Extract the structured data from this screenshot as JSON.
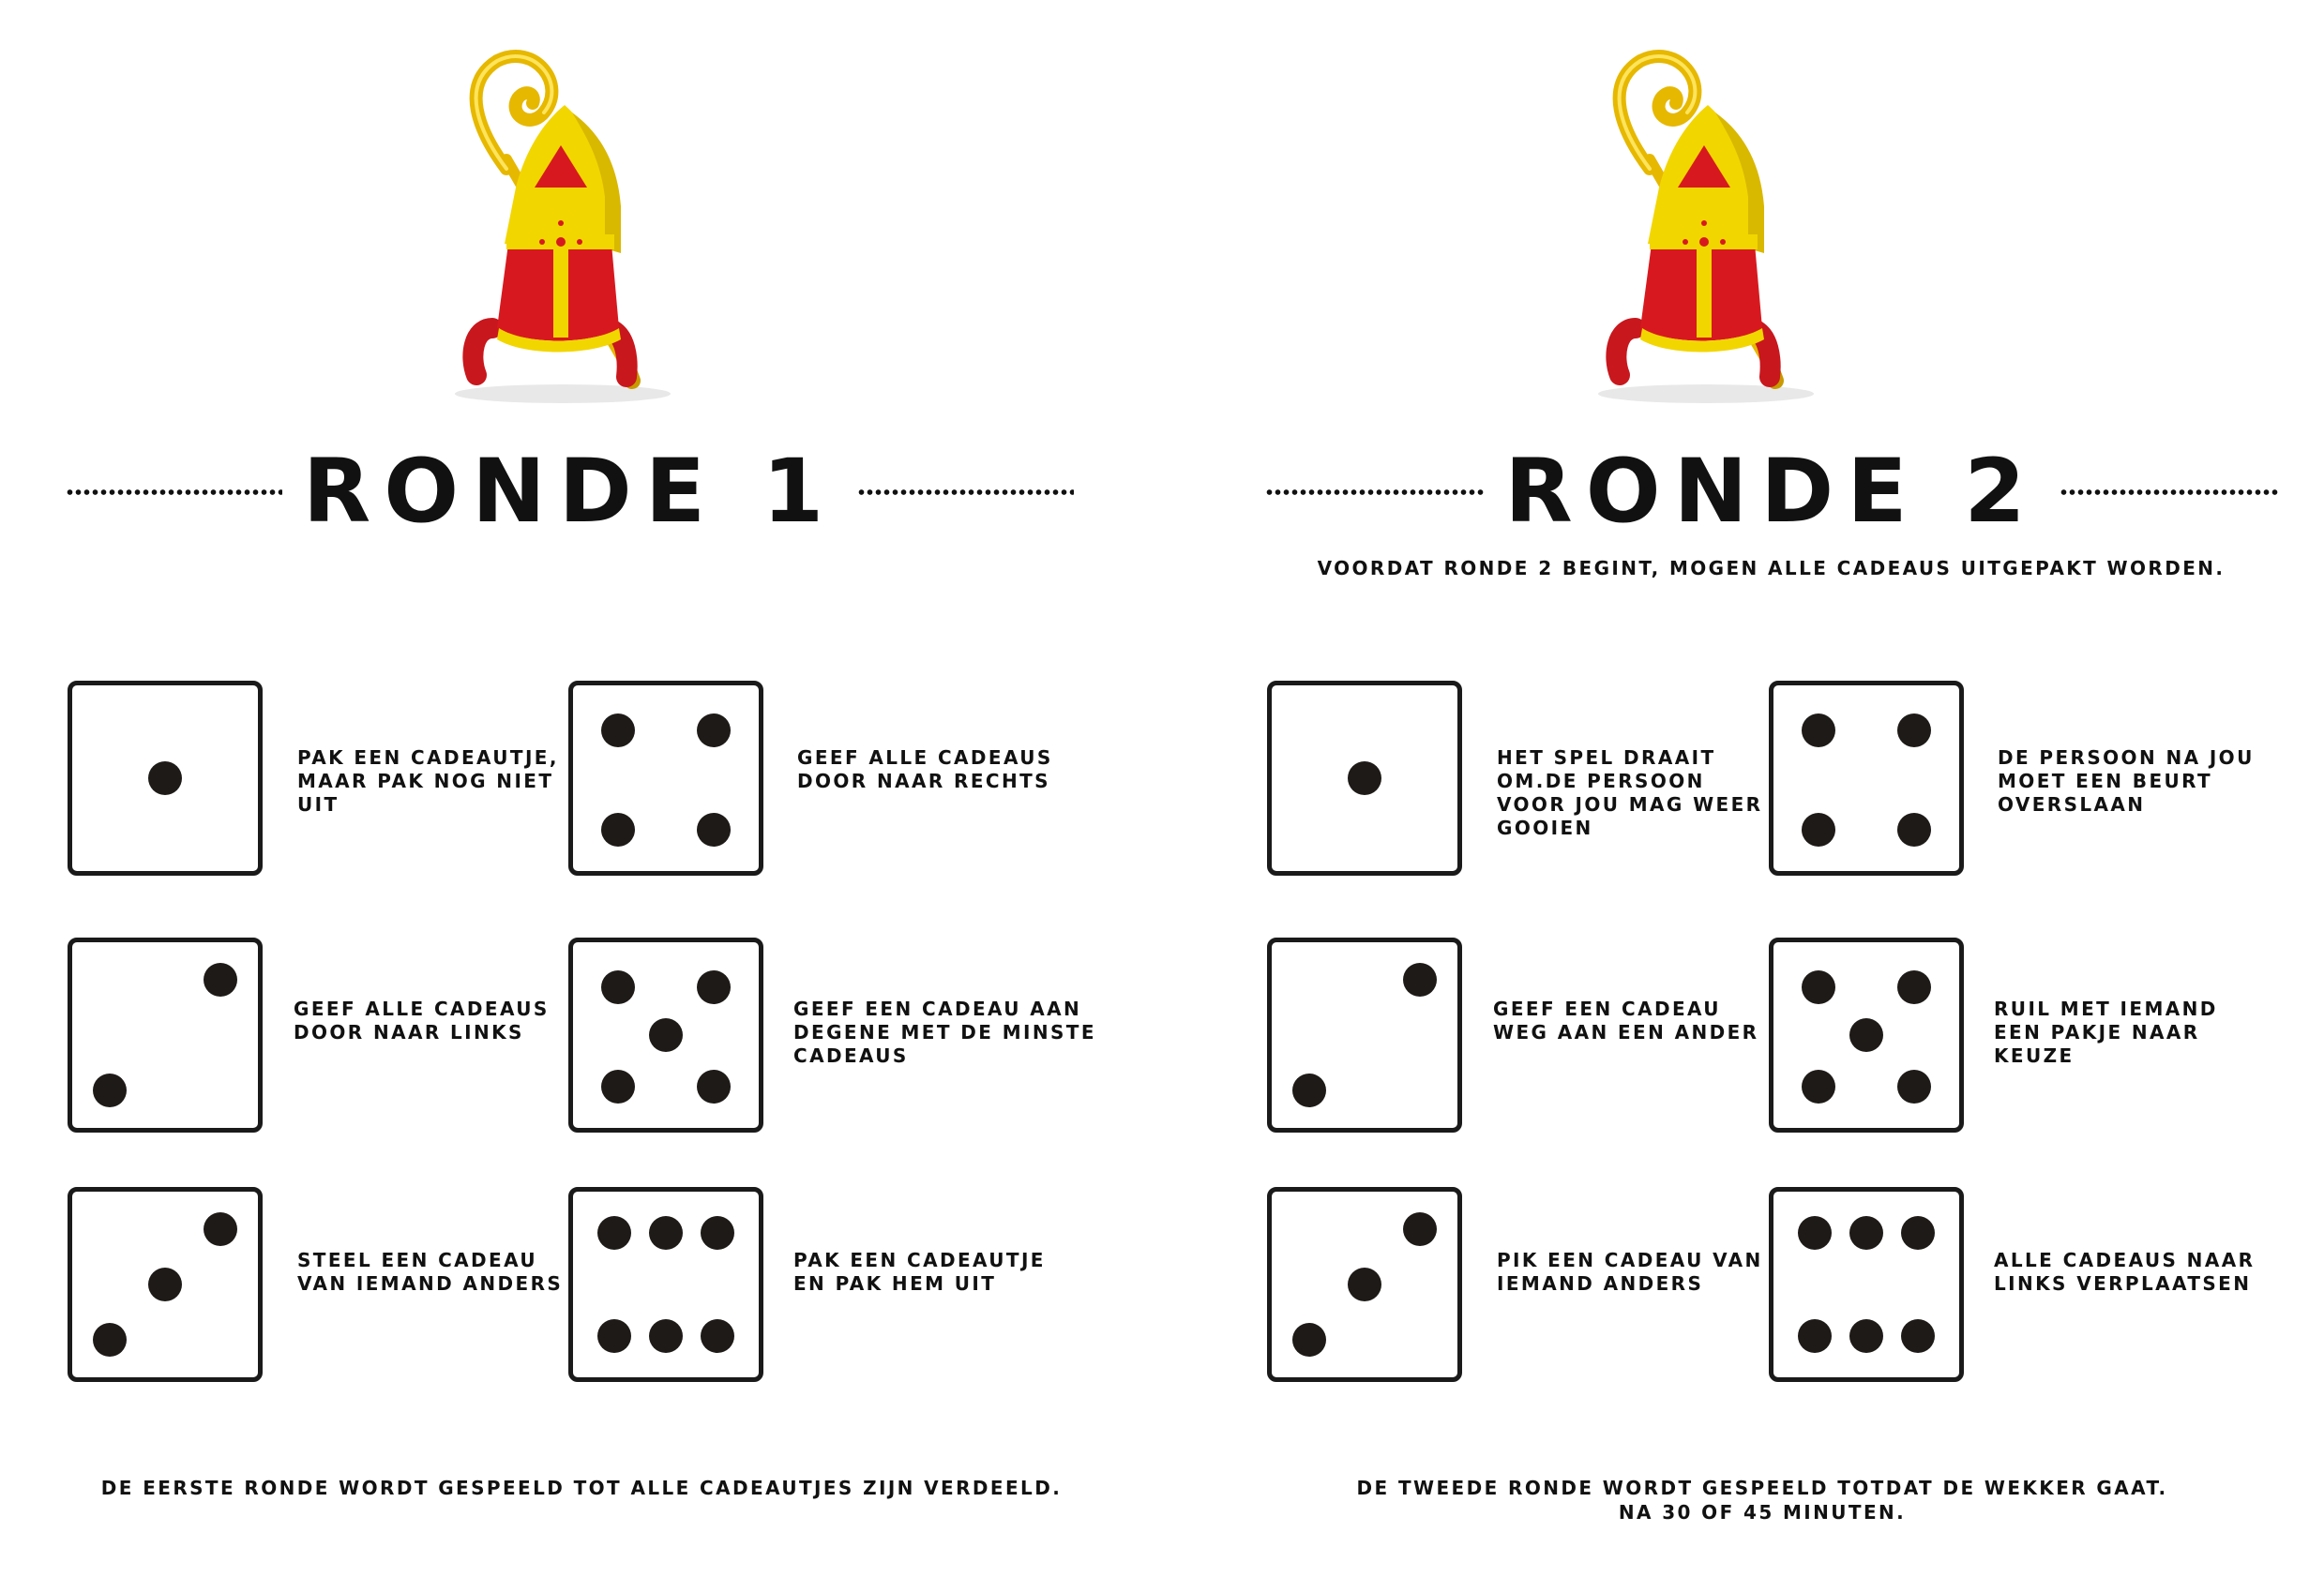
{
  "rounds": [
    {
      "title": "RONDE 1",
      "subtitle": "",
      "items": [
        {
          "die": 1,
          "text": "PAK EEN CADEAUTJE, MAAR PAK NOG NIET UIT"
        },
        {
          "die": 2,
          "text": "GEEF ALLE CADEAUS DOOR NAAR LINKS"
        },
        {
          "die": 3,
          "text": "STEEL EEN CADEAU VAN IEMAND ANDERS"
        },
        {
          "die": 4,
          "text": "GEEF ALLE CADEAUS DOOR NAAR RECHTS"
        },
        {
          "die": 5,
          "text": "GEEF EEN CADEAU AAN DEGENE MET DE MINSTE CADEAUS"
        },
        {
          "die": 6,
          "text": "PAK EEN CADEAUTJE EN PAK HEM UIT"
        }
      ],
      "footer": "DE EERSTE RONDE WORDT GESPEELD TOT ALLE CADEAUTJES ZIJN VERDEELD.",
      "footer_line2": ""
    },
    {
      "title": "RONDE 2",
      "subtitle": "VOORDAT RONDE 2 BEGINT, MOGEN ALLE CADEAUS UITGEPAKT WORDEN.",
      "items": [
        {
          "die": 1,
          "text": "HET SPEL DRAAIT OM.DE PERSOON VOOR JOU MAG WEER GOOIEN"
        },
        {
          "die": 2,
          "text": "GEEF EEN CADEAU WEG AAN EEN ANDER"
        },
        {
          "die": 3,
          "text": "PIK EEN CADEAU VAN IEMAND ANDERS"
        },
        {
          "die": 4,
          "text": "DE PERSOON NA JOU MOET EEN BEURT OVERSLAAN"
        },
        {
          "die": 5,
          "text": "RUIL MET IEMAND EEN PAKJE NAAR KEUZE"
        },
        {
          "die": 6,
          "text": "ALLE CADEAUS NAAR LINKS VERPLAATSEN"
        }
      ],
      "footer": "DE TWEEDE RONDE WORDT GESPEELD TOTDAT DE WEKKER GAAT.",
      "footer_line2": "NA 30 OF 45 MINUTEN."
    }
  ],
  "icons": {
    "mascot": "sinterklaas-mitre-staff-icon",
    "die": "die-face-icon"
  },
  "colors": {
    "mitre_red": "#d7191f",
    "mitre_yellow": "#f2d600",
    "staff_gold": "#e6b800",
    "ink": "#111111"
  }
}
